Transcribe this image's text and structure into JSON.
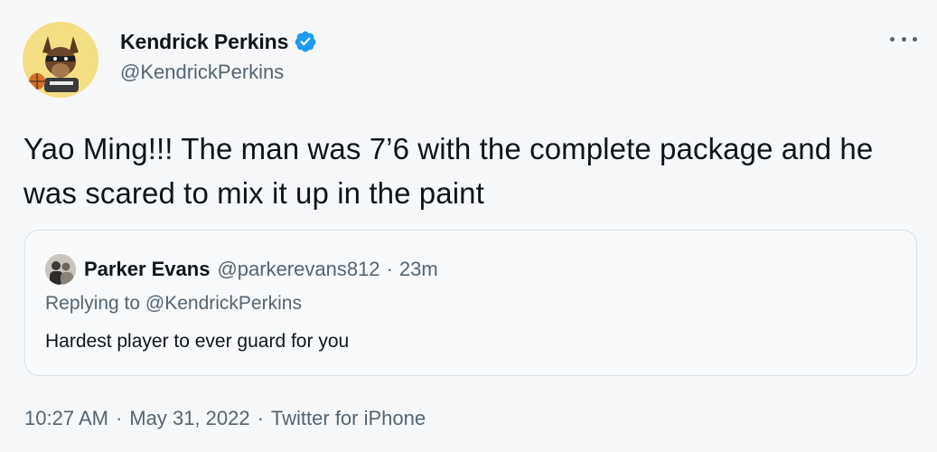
{
  "author": {
    "name": "Kendrick Perkins",
    "handle": "@KendrickPerkins",
    "verified": true,
    "avatar_icon": "cartoon-dog-avatar-icon"
  },
  "menu_icon": "more-options-icon",
  "tweet": {
    "text": "Yao Ming!!! The man was 7’6 with the complete package and he was scared to mix it up in the paint"
  },
  "quoted_tweet": {
    "author_name": "Parker Evans",
    "author_handle": "@parkerevans812",
    "separator": "·",
    "time_ago": "23m",
    "replying_to": "Replying to @KendrickPerkins",
    "text": "Hardest player to ever guard for you"
  },
  "meta": {
    "time": "10:27 AM",
    "date": "May 31, 2022",
    "source": "Twitter for iPhone",
    "separator": "·"
  },
  "colors": {
    "verified_badge": "#1d9bf0",
    "secondary_text": "#536471",
    "primary_text": "#0f1419",
    "border": "#dadfe3"
  }
}
